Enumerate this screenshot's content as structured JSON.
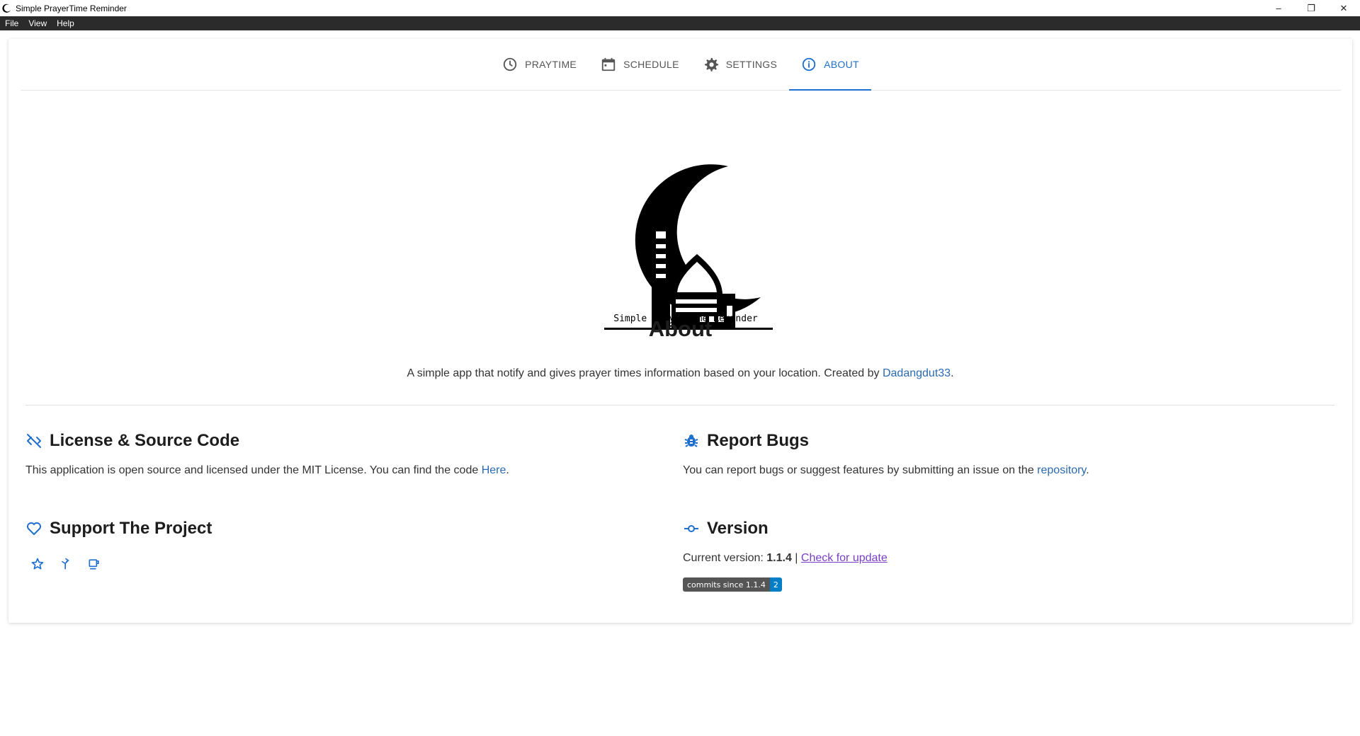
{
  "window": {
    "title": "Simple PrayerTime Reminder",
    "controls": {
      "minimize": "–",
      "restore": "❐",
      "close": "✕"
    }
  },
  "menu": [
    "File",
    "View",
    "Help"
  ],
  "tabs": [
    {
      "label": "PRAYTIME",
      "icon": "clock-icon",
      "active": false
    },
    {
      "label": "SCHEDULE",
      "icon": "calendar-icon",
      "active": false
    },
    {
      "label": "SETTINGS",
      "icon": "gear-icon",
      "active": false
    },
    {
      "label": "ABOUT",
      "icon": "info-icon",
      "active": true
    }
  ],
  "logo": {
    "caption": "Simple PrayerTime Reminder"
  },
  "about": {
    "title": "About",
    "desc_prefix": "A simple app that notify and gives prayer times information based on your location. Created by ",
    "author": "Dadangdut33",
    "desc_suffix": "."
  },
  "license": {
    "title": "License & Source Code",
    "text_prefix": "This application is open source and licensed under the MIT License. You can find the code ",
    "link": "Here",
    "text_suffix": "."
  },
  "bugs": {
    "title": "Report Bugs",
    "text_prefix": "You can report bugs or suggest features by submitting an issue on the ",
    "link": "repository",
    "text_suffix": "."
  },
  "support": {
    "title": "Support The Project",
    "icons": [
      "star-icon",
      "fork-icon",
      "coffee-icon"
    ]
  },
  "version": {
    "title": "Version",
    "label": "Current version: ",
    "number": "1.1.4",
    "separator": " | ",
    "update_link": "Check for update",
    "badge_left": "commits since 1.1.4",
    "badge_right": "2"
  },
  "colors": {
    "accent": "#1f6fd1",
    "menubar": "#2b2b2b",
    "link": "#2a6ab3",
    "visited": "#7b3fc6",
    "badge_blue": "#007ec6"
  }
}
